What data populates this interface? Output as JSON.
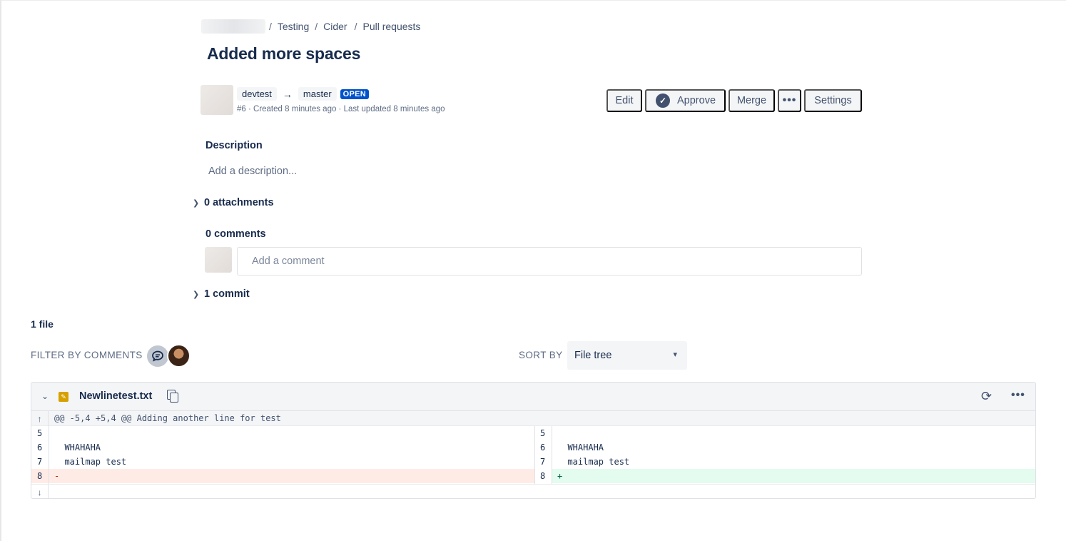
{
  "breadcrumb": {
    "items": [
      "Testing",
      "Cider",
      "Pull requests"
    ],
    "separator": "/"
  },
  "pr": {
    "title": "Added more spaces",
    "source_branch": "devtest",
    "target_branch": "master",
    "status": "OPEN",
    "meta": "#6 · Created 8 minutes ago · Last updated 8 minutes ago"
  },
  "actions": {
    "edit": "Edit",
    "approve": "Approve",
    "merge": "Merge",
    "more": "•••",
    "settings": "Settings"
  },
  "description": {
    "title": "Description",
    "placeholder": "Add a description..."
  },
  "attachments": {
    "label": "0 attachments"
  },
  "comments": {
    "title": "0 comments",
    "input_placeholder": "Add a comment"
  },
  "commits": {
    "label": "1 commit"
  },
  "files": {
    "count_label": "1 file",
    "filter_label": "FILTER BY COMMENTS",
    "sort_label": "SORT BY",
    "sort_value": "File tree"
  },
  "diff": {
    "file_name": "Newlinetest.txt",
    "hunk_header": "@@ -5,4 +5,4 @@ Adding another line for test",
    "left": [
      {
        "num": "5",
        "text": "",
        "type": "context"
      },
      {
        "num": "6",
        "text": "  WHAHAHA",
        "type": "context"
      },
      {
        "num": "7",
        "text": "  mailmap test",
        "type": "context"
      },
      {
        "num": "8",
        "text": "-",
        "type": "del"
      }
    ],
    "right": [
      {
        "num": "5",
        "text": "",
        "type": "context"
      },
      {
        "num": "6",
        "text": "  WHAHAHA",
        "type": "context"
      },
      {
        "num": "7",
        "text": "  mailmap test",
        "type": "context"
      },
      {
        "num": "8",
        "text": "+",
        "type": "add"
      }
    ]
  },
  "colors": {
    "primary_text": "#172b4d",
    "badge_open": "#0052cc",
    "deletion_bg": "#ffebe6",
    "addition_bg": "#e3fcef",
    "modified_icon": "#d6a000"
  },
  "icons": {
    "arrow": "→",
    "approve": "check-circle-icon",
    "expand": "chevron-right-icon",
    "collapse": "chevron-down-icon",
    "modified": "pencil-icon",
    "copy": "copy-icon",
    "comment": "comment-add-icon",
    "scroll_up": "arrow-up-icon",
    "scroll_down": "arrow-down-icon"
  }
}
